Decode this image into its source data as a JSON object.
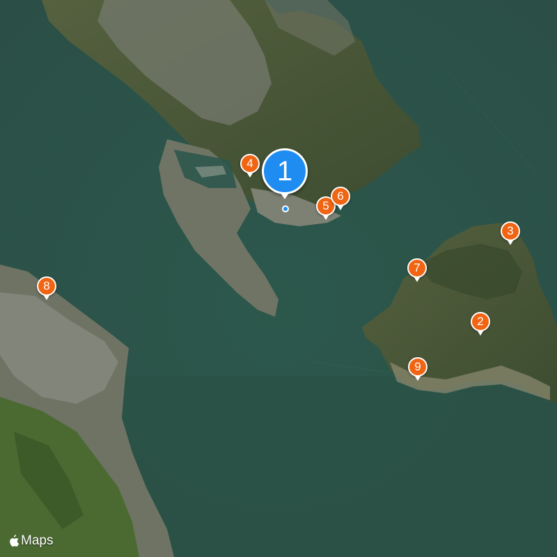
{
  "map": {
    "type": "satellite",
    "attribution": "Maps",
    "attribution_icon": "apple-logo-icon",
    "colors": {
      "water": "#2f5a4f",
      "land": "#4a5a3c",
      "urban": "#8a8d86",
      "pin_orange": "#f06412",
      "pin_selected": "#1f8cf2"
    }
  },
  "pins": {
    "p1": "1",
    "p2": "2",
    "p3": "3",
    "p4": "4",
    "p5": "5",
    "p6": "6",
    "p7": "7",
    "p8": "8",
    "p9": "9"
  }
}
